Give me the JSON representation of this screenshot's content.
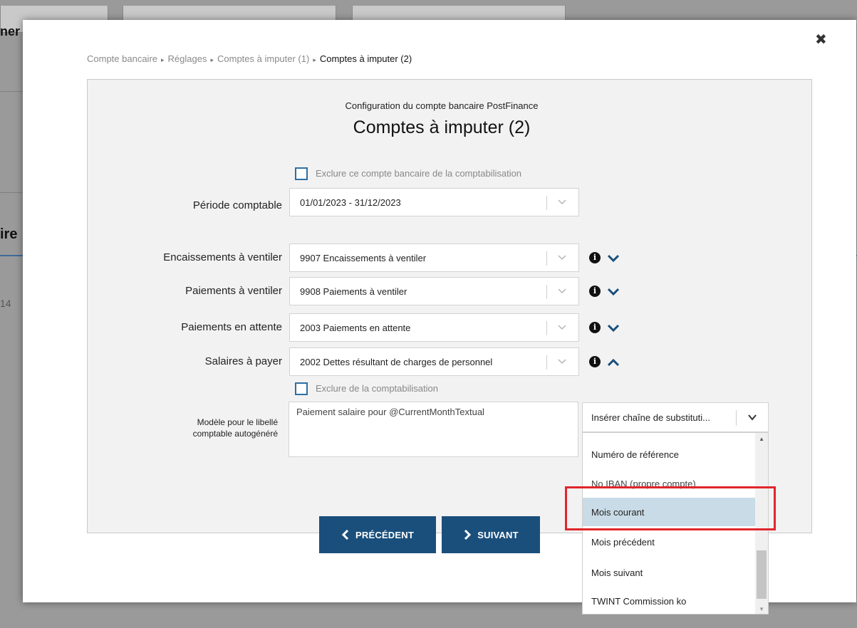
{
  "background": {
    "text_left_1": "ner",
    "text_left_2": "ire",
    "text_left_3": "14"
  },
  "modal": {
    "close_glyph": "✖",
    "breadcrumb": {
      "items": [
        "Compte bancaire",
        "Réglages",
        "Comptes à imputer (1)"
      ],
      "current": "Comptes à imputer (2)",
      "separator": "▸"
    },
    "subtitle": "Configuration du compte bancaire PostFinance",
    "title": "Comptes à imputer (2)",
    "exclude_account": {
      "label": "Exclure ce compte bancaire de la comptabilisation",
      "checked": false
    },
    "period": {
      "label": "Période comptable",
      "value": "01/01/2023 - 31/12/2023"
    },
    "accounts": [
      {
        "label": "Encaissements à ventiler",
        "value": "9907 Encaissements à ventiler",
        "expanded": false
      },
      {
        "label": "Paiements à ventiler",
        "value": "9908 Paiements à ventiler",
        "expanded": false
      },
      {
        "label": "Paiements en attente",
        "value": "2003 Paiements en attente",
        "expanded": false
      },
      {
        "label": "Salaires à payer",
        "value": "2002 Dettes résultant de charges de personnel",
        "expanded": true
      }
    ],
    "exclude_booking": {
      "label": "Exclure de la comptabilisation",
      "checked": false
    },
    "template": {
      "label_line1": "Modèle pour le libellé",
      "label_line2": "comptable autogénéré",
      "value": "Paiement salaire pour @CurrentMonthTextual"
    },
    "insert_select": {
      "value": "Insérer chaîne de substituti...",
      "options": [
        "Numéro de référence",
        "No IBAN (propre compte)",
        "Mois courant",
        "Mois précédent",
        "Mois suivant",
        "TWINT Commission ko"
      ],
      "active_option": "Mois courant"
    },
    "buttons": {
      "previous": "PRÉCÉDENT",
      "next": "SUIVANT"
    }
  },
  "colors": {
    "primary": "#1a4f7c",
    "checkbox": "#2f6fa3",
    "highlight": "#e0262b",
    "active_option": "#c8dbe6"
  }
}
